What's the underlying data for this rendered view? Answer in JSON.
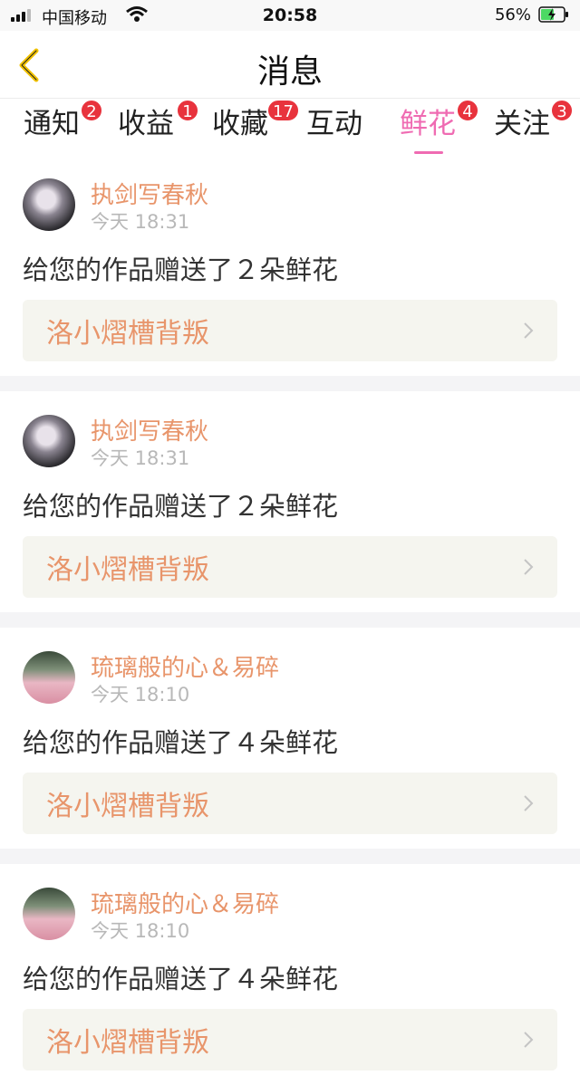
{
  "status_bar": {
    "carrier": "中国移动",
    "time": "20:58",
    "battery_pct": "56%"
  },
  "header": {
    "title": "消息",
    "back_icon": "chevron-left-icon",
    "accent_color": "#f2c200"
  },
  "tabs": [
    {
      "label": "通知",
      "badge": "2"
    },
    {
      "label": "收益",
      "badge": "1"
    },
    {
      "label": "收藏",
      "badge": "17"
    },
    {
      "label": "互动",
      "badge": ""
    },
    {
      "label": "鲜花",
      "badge": "4",
      "active": true
    },
    {
      "label": "关注",
      "badge": "3"
    }
  ],
  "active_tab_color": "#ef6bb2",
  "messages": [
    {
      "user": "执剑写春秋",
      "time": "今天 18:31",
      "text": "给您的作品赠送了２朵鲜花",
      "work": "洛小熠槽背叛"
    },
    {
      "user": "执剑写春秋",
      "time": "今天 18:31",
      "text": "给您的作品赠送了２朵鲜花",
      "work": "洛小熠槽背叛"
    },
    {
      "user": "琉璃般的心＆易碎",
      "time": "今天 18:10",
      "text": "给您的作品赠送了４朵鲜花",
      "work": "洛小熠槽背叛"
    },
    {
      "user": "琉璃般的心＆易碎",
      "time": "今天 18:10",
      "text": "给您的作品赠送了４朵鲜花",
      "work": "洛小熠槽背叛"
    }
  ]
}
